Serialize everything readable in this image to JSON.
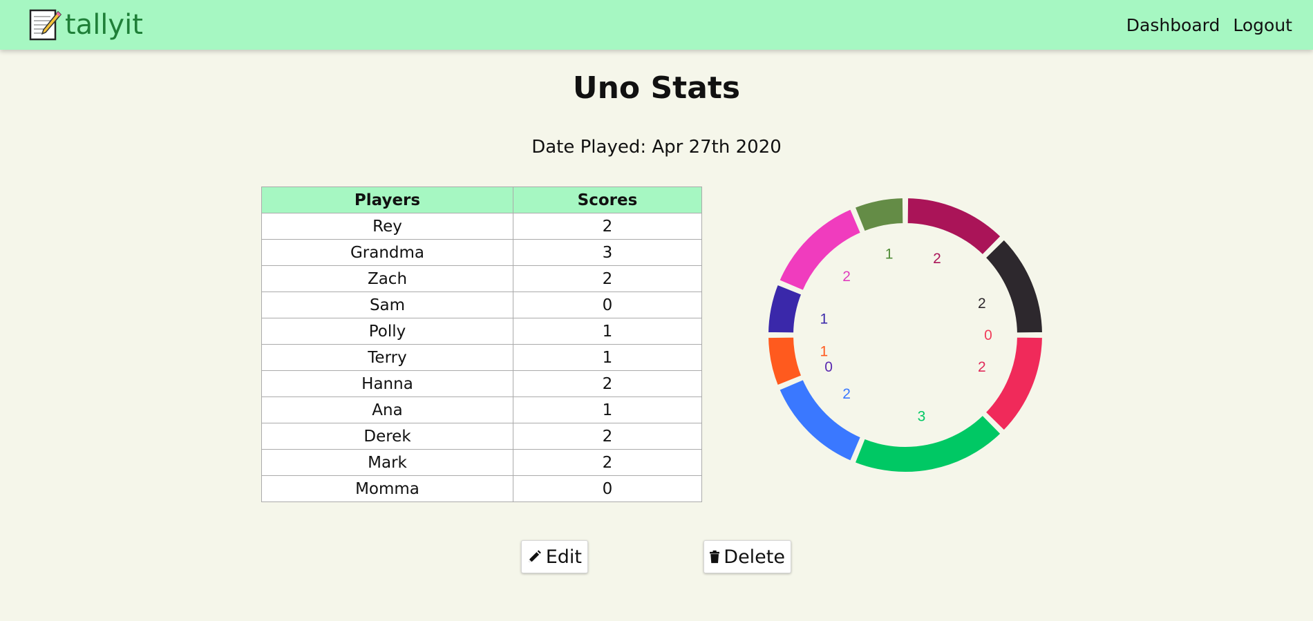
{
  "brand": {
    "name": "tallyit",
    "icon": "notepad-pencil-icon"
  },
  "nav": {
    "dashboard": "Dashboard",
    "logout": "Logout"
  },
  "page": {
    "title": "Uno Stats",
    "date_label": "Date Played: Apr 27th 2020"
  },
  "table": {
    "headers": [
      "Players",
      "Scores"
    ],
    "rows": [
      [
        "Rey",
        "2"
      ],
      [
        "Grandma",
        "3"
      ],
      [
        "Zach",
        "2"
      ],
      [
        "Sam",
        "0"
      ],
      [
        "Polly",
        "1"
      ],
      [
        "Terry",
        "1"
      ],
      [
        "Hanna",
        "2"
      ],
      [
        "Ana",
        "1"
      ],
      [
        "Derek",
        "2"
      ],
      [
        "Mark",
        "2"
      ],
      [
        "Momma",
        "0"
      ]
    ]
  },
  "buttons": {
    "edit": "Edit",
    "delete": "Delete",
    "edit_icon": "pencil-icon",
    "delete_icon": "trash-icon"
  },
  "chart_data": {
    "type": "pie",
    "categories": [
      "Rey",
      "Grandma",
      "Zach",
      "Sam",
      "Polly",
      "Terry",
      "Hanna",
      "Ana",
      "Derek",
      "Mark",
      "Momma"
    ],
    "values": [
      2,
      3,
      2,
      0,
      1,
      1,
      2,
      1,
      2,
      2,
      0
    ],
    "colors": [
      "#f02a5a",
      "#00c864",
      "#3a78ff",
      "#5a2ab0",
      "#ff5a1e",
      "#3a28aa",
      "#f03cbe",
      "#648c46",
      "#aa1458",
      "#2d282d",
      "#f03c5a"
    ],
    "value_label_colors": [
      "#e02a5a",
      "#00c864",
      "#3a78ff",
      "#5a2ab0",
      "#ff5a1e",
      "#3a28aa",
      "#e03cbe",
      "#4f8c36",
      "#aa1458",
      "#2d282d",
      "#f03c5a"
    ],
    "style": "donut"
  }
}
